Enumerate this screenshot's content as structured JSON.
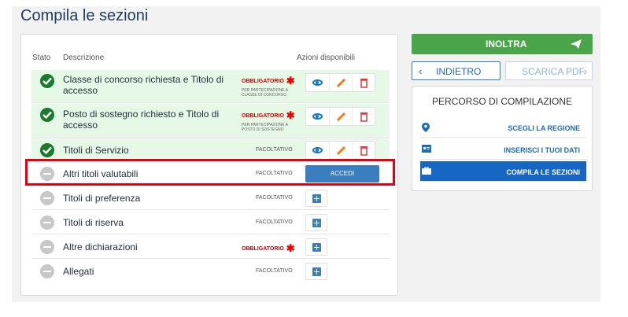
{
  "page": {
    "title": "Compila le sezioni"
  },
  "table": {
    "headers": {
      "stato": "Stato",
      "descrizione": "Descrizione",
      "azioni": "Azioni disponibili"
    },
    "rows": [
      {
        "label": "Classe di concorso richiesta e Titolo di accesso",
        "status": "completed",
        "requirement": "OBBLIGATORIO",
        "note": "PER PARTECIPAZIONE A CLASSE DI CONCORSO",
        "actions": [
          "view",
          "edit",
          "delete"
        ]
      },
      {
        "label": "Posto di sostegno richiesto e Titolo di accesso",
        "status": "completed",
        "requirement": "OBBLIGATORIO",
        "note": "PER PARTECIPAZIONE A POSTO DI SOSTEGNO",
        "actions": [
          "view",
          "edit",
          "delete"
        ]
      },
      {
        "label": "Titoli di Servizio",
        "status": "completed",
        "requirement": "FACOLTATIVO",
        "actions": [
          "view",
          "edit",
          "delete"
        ]
      },
      {
        "label": "Altri titoli valutabili",
        "status": "pending",
        "requirement": "FACOLTATIVO",
        "action_label": "ACCEDI"
      },
      {
        "label": "Titoli di preferenza",
        "status": "pending",
        "requirement": "FACOLTATIVO",
        "actions": [
          "add"
        ]
      },
      {
        "label": "Titoli di riserva",
        "status": "pending",
        "requirement": "FACOLTATIVO",
        "actions": [
          "add"
        ]
      },
      {
        "label": "Altre dichiarazioni",
        "status": "pending",
        "requirement": "OBBLIGATORIO",
        "actions": [
          "add"
        ]
      },
      {
        "label": "Allegati",
        "status": "pending",
        "requirement": "FACOLTATIVO",
        "actions": [
          "add"
        ]
      }
    ]
  },
  "sidebar": {
    "inoltra_label": "INOLTRA",
    "back_label": "INDIETRO",
    "pdf_label": "SCARICA PDF",
    "percorso_title": "PERCORSO DI COMPILAZIONE",
    "steps": [
      {
        "label": "SCEGLI LA REGIONE",
        "icon": "map-marker-icon"
      },
      {
        "label": "INSERISCI I TUOI DATI",
        "icon": "id-card-icon"
      },
      {
        "label": "COMPILA LE SEZIONI",
        "icon": "briefcase-icon",
        "active": true
      }
    ]
  },
  "colors": {
    "primary": "#1666c4",
    "success": "#4aa54a",
    "required": "#e00000",
    "highlight": "#e3000f"
  }
}
